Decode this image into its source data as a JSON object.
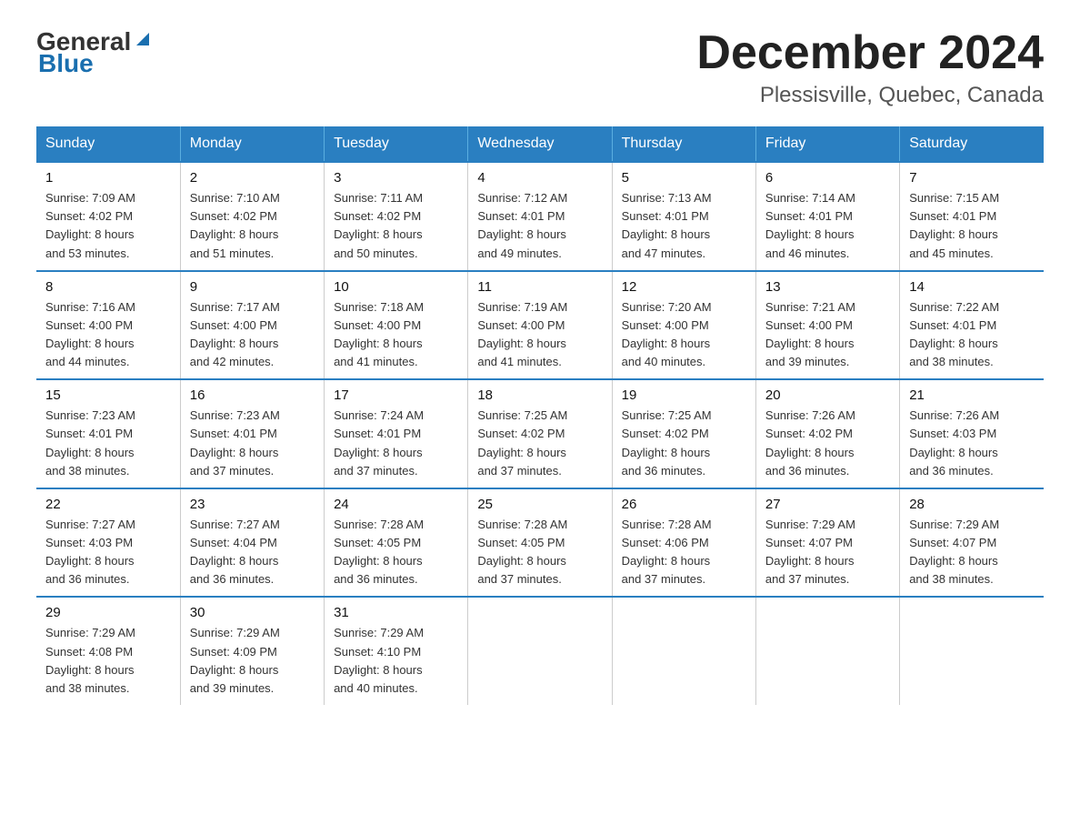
{
  "header": {
    "logo_general": "General",
    "logo_blue": "Blue",
    "title": "December 2024",
    "subtitle": "Plessisville, Quebec, Canada"
  },
  "weekdays": [
    "Sunday",
    "Monday",
    "Tuesday",
    "Wednesday",
    "Thursday",
    "Friday",
    "Saturday"
  ],
  "weeks": [
    [
      {
        "day": "1",
        "info": "Sunrise: 7:09 AM\nSunset: 4:02 PM\nDaylight: 8 hours\nand 53 minutes."
      },
      {
        "day": "2",
        "info": "Sunrise: 7:10 AM\nSunset: 4:02 PM\nDaylight: 8 hours\nand 51 minutes."
      },
      {
        "day": "3",
        "info": "Sunrise: 7:11 AM\nSunset: 4:02 PM\nDaylight: 8 hours\nand 50 minutes."
      },
      {
        "day": "4",
        "info": "Sunrise: 7:12 AM\nSunset: 4:01 PM\nDaylight: 8 hours\nand 49 minutes."
      },
      {
        "day": "5",
        "info": "Sunrise: 7:13 AM\nSunset: 4:01 PM\nDaylight: 8 hours\nand 47 minutes."
      },
      {
        "day": "6",
        "info": "Sunrise: 7:14 AM\nSunset: 4:01 PM\nDaylight: 8 hours\nand 46 minutes."
      },
      {
        "day": "7",
        "info": "Sunrise: 7:15 AM\nSunset: 4:01 PM\nDaylight: 8 hours\nand 45 minutes."
      }
    ],
    [
      {
        "day": "8",
        "info": "Sunrise: 7:16 AM\nSunset: 4:00 PM\nDaylight: 8 hours\nand 44 minutes."
      },
      {
        "day": "9",
        "info": "Sunrise: 7:17 AM\nSunset: 4:00 PM\nDaylight: 8 hours\nand 42 minutes."
      },
      {
        "day": "10",
        "info": "Sunrise: 7:18 AM\nSunset: 4:00 PM\nDaylight: 8 hours\nand 41 minutes."
      },
      {
        "day": "11",
        "info": "Sunrise: 7:19 AM\nSunset: 4:00 PM\nDaylight: 8 hours\nand 41 minutes."
      },
      {
        "day": "12",
        "info": "Sunrise: 7:20 AM\nSunset: 4:00 PM\nDaylight: 8 hours\nand 40 minutes."
      },
      {
        "day": "13",
        "info": "Sunrise: 7:21 AM\nSunset: 4:00 PM\nDaylight: 8 hours\nand 39 minutes."
      },
      {
        "day": "14",
        "info": "Sunrise: 7:22 AM\nSunset: 4:01 PM\nDaylight: 8 hours\nand 38 minutes."
      }
    ],
    [
      {
        "day": "15",
        "info": "Sunrise: 7:23 AM\nSunset: 4:01 PM\nDaylight: 8 hours\nand 38 minutes."
      },
      {
        "day": "16",
        "info": "Sunrise: 7:23 AM\nSunset: 4:01 PM\nDaylight: 8 hours\nand 37 minutes."
      },
      {
        "day": "17",
        "info": "Sunrise: 7:24 AM\nSunset: 4:01 PM\nDaylight: 8 hours\nand 37 minutes."
      },
      {
        "day": "18",
        "info": "Sunrise: 7:25 AM\nSunset: 4:02 PM\nDaylight: 8 hours\nand 37 minutes."
      },
      {
        "day": "19",
        "info": "Sunrise: 7:25 AM\nSunset: 4:02 PM\nDaylight: 8 hours\nand 36 minutes."
      },
      {
        "day": "20",
        "info": "Sunrise: 7:26 AM\nSunset: 4:02 PM\nDaylight: 8 hours\nand 36 minutes."
      },
      {
        "day": "21",
        "info": "Sunrise: 7:26 AM\nSunset: 4:03 PM\nDaylight: 8 hours\nand 36 minutes."
      }
    ],
    [
      {
        "day": "22",
        "info": "Sunrise: 7:27 AM\nSunset: 4:03 PM\nDaylight: 8 hours\nand 36 minutes."
      },
      {
        "day": "23",
        "info": "Sunrise: 7:27 AM\nSunset: 4:04 PM\nDaylight: 8 hours\nand 36 minutes."
      },
      {
        "day": "24",
        "info": "Sunrise: 7:28 AM\nSunset: 4:05 PM\nDaylight: 8 hours\nand 36 minutes."
      },
      {
        "day": "25",
        "info": "Sunrise: 7:28 AM\nSunset: 4:05 PM\nDaylight: 8 hours\nand 37 minutes."
      },
      {
        "day": "26",
        "info": "Sunrise: 7:28 AM\nSunset: 4:06 PM\nDaylight: 8 hours\nand 37 minutes."
      },
      {
        "day": "27",
        "info": "Sunrise: 7:29 AM\nSunset: 4:07 PM\nDaylight: 8 hours\nand 37 minutes."
      },
      {
        "day": "28",
        "info": "Sunrise: 7:29 AM\nSunset: 4:07 PM\nDaylight: 8 hours\nand 38 minutes."
      }
    ],
    [
      {
        "day": "29",
        "info": "Sunrise: 7:29 AM\nSunset: 4:08 PM\nDaylight: 8 hours\nand 38 minutes."
      },
      {
        "day": "30",
        "info": "Sunrise: 7:29 AM\nSunset: 4:09 PM\nDaylight: 8 hours\nand 39 minutes."
      },
      {
        "day": "31",
        "info": "Sunrise: 7:29 AM\nSunset: 4:10 PM\nDaylight: 8 hours\nand 40 minutes."
      },
      {
        "day": "",
        "info": ""
      },
      {
        "day": "",
        "info": ""
      },
      {
        "day": "",
        "info": ""
      },
      {
        "day": "",
        "info": ""
      }
    ]
  ]
}
